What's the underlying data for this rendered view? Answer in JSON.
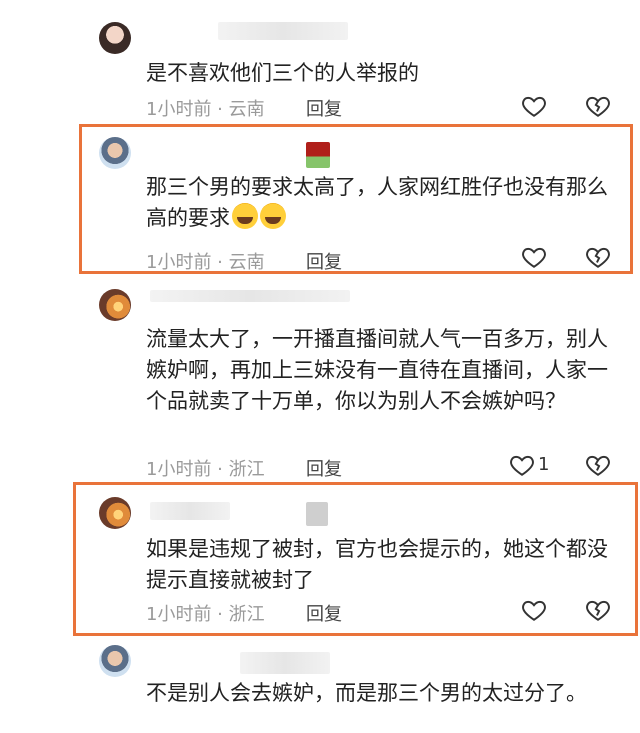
{
  "comments": [
    {
      "text": "是不喜欢他们三个的人举报的",
      "meta": "1小时前 · 云南",
      "reply": "回复",
      "likes": ""
    },
    {
      "text": "那三个男的要求太高了，人家网红胜仔也没有那么高的要求",
      "meta": "1小时前 · 云南",
      "reply": "回复",
      "likes": "",
      "emoji": "rolling-laughing-emoji"
    },
    {
      "text": "流量太大了，一开播直播间就人气一百多万，别人嫉妒啊，再加上三妹没有一直待在直播间，人家一个品就卖了十万单，你以为别人不会嫉妒吗？",
      "meta": "1小时前 · 浙江",
      "reply": "回复",
      "likes": "1"
    },
    {
      "text": "如果是违规了被封，官方也会提示的，她这个都没提示直接就被封了",
      "meta": "1小时前 · 浙江",
      "reply": "回复",
      "likes": ""
    },
    {
      "text": "不是别人会去嫉妒，而是那三个男的太过分了。"
    }
  ],
  "colors": {
    "highlight": "#e9733a",
    "meta": "#9a9a9a",
    "text": "#222222"
  },
  "icons": {
    "like": "heart-outline-icon",
    "dislike": "broken-heart-icon"
  }
}
